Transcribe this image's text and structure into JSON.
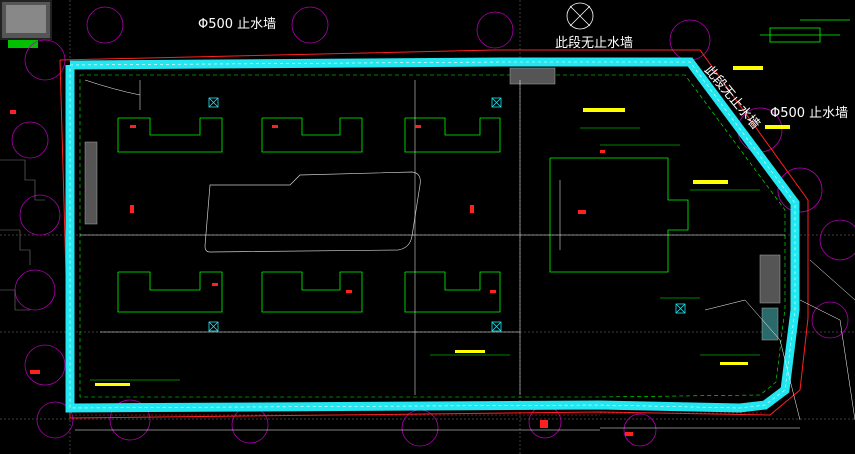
{
  "drawing": {
    "background": "#000000",
    "labels": {
      "cutoff_wall_left": "Φ500 止水墙",
      "cutoff_wall_right": "Φ500 止水墙",
      "no_cutoff_section_1": "此段无止水墙",
      "no_cutoff_section_2": "此段无止水墙"
    },
    "colors": {
      "cutoff_wall": "#22e6f0",
      "structure_lines": "#00ff00",
      "annotation": "#ffff00",
      "markers": "#ff2020",
      "circles": "#b000b0",
      "grid": "#ffffff"
    }
  }
}
